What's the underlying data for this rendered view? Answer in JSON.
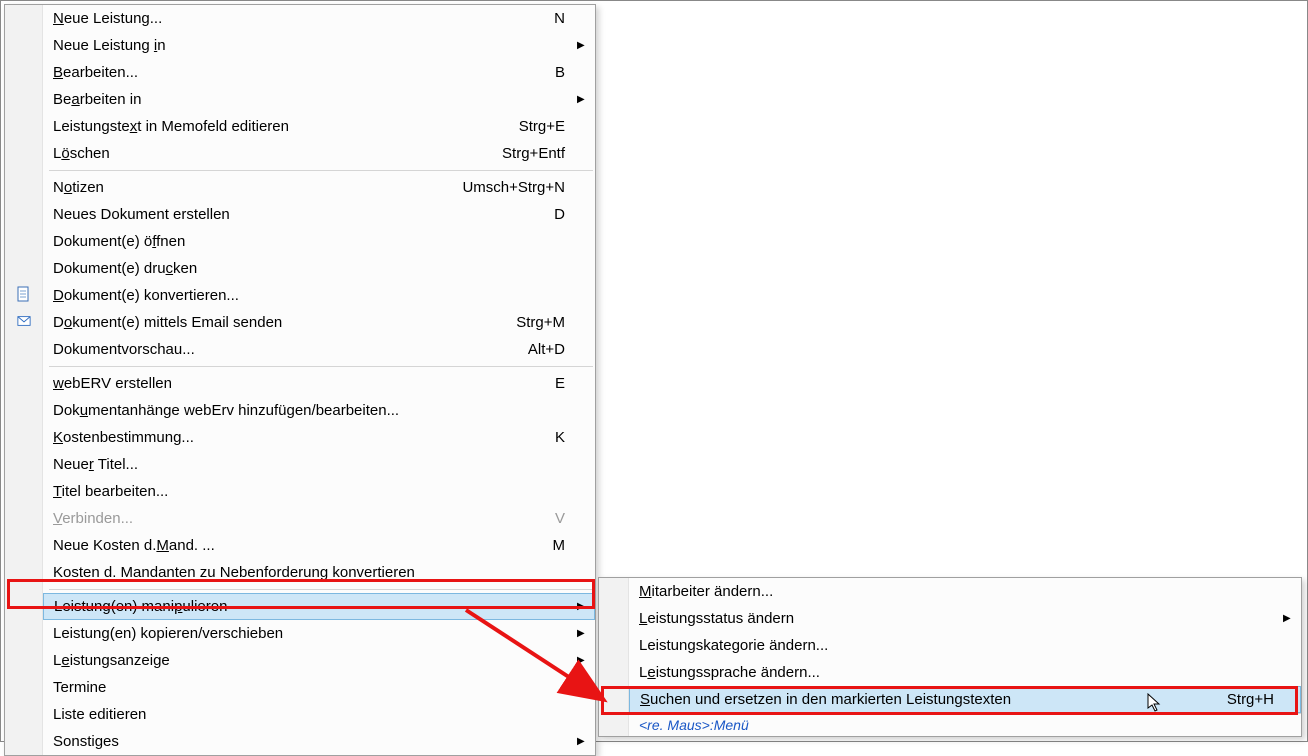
{
  "mainMenu": {
    "items": [
      {
        "type": "item",
        "pre": "",
        "u": "N",
        "post": "eue Leistung...",
        "shortcut": "N",
        "arrow": false
      },
      {
        "type": "item",
        "pre": "Neue Leistung ",
        "u": "i",
        "post": "n",
        "shortcut": "",
        "arrow": true
      },
      {
        "type": "item",
        "pre": "",
        "u": "B",
        "post": "earbeiten...",
        "shortcut": "B",
        "arrow": false
      },
      {
        "type": "item",
        "pre": "Be",
        "u": "a",
        "post": "rbeiten in",
        "shortcut": "",
        "arrow": true
      },
      {
        "type": "item",
        "pre": "Leistungste",
        "u": "x",
        "post": "t in Memofeld editieren",
        "shortcut": "Strg+E",
        "arrow": false
      },
      {
        "type": "item",
        "pre": "L",
        "u": "ö",
        "post": "schen",
        "shortcut": "Strg+Entf",
        "arrow": false
      },
      {
        "type": "sep"
      },
      {
        "type": "item",
        "pre": "N",
        "u": "o",
        "post": "tizen",
        "shortcut": "Umsch+Strg+N",
        "arrow": false
      },
      {
        "type": "item",
        "pre": "Neues Dokument erstellen",
        "u": "",
        "post": "",
        "shortcut": "D",
        "arrow": false
      },
      {
        "type": "item",
        "pre": "Dokument(e) ö",
        "u": "f",
        "post": "fnen",
        "shortcut": "",
        "arrow": false
      },
      {
        "type": "item",
        "pre": "Dokument(e) dru",
        "u": "c",
        "post": "ken",
        "shortcut": "",
        "arrow": false
      },
      {
        "type": "item",
        "pre": "",
        "u": "D",
        "post": "okument(e) konvertieren...",
        "shortcut": "",
        "arrow": false,
        "icon": "doc"
      },
      {
        "type": "item",
        "pre": "D",
        "u": "o",
        "post": "kument(e) mittels Email senden",
        "shortcut": "Strg+M",
        "arrow": false,
        "icon": "mail"
      },
      {
        "type": "item",
        "pre": "Dokumentvorschau...",
        "u": "",
        "post": "",
        "shortcut": "Alt+D",
        "arrow": false
      },
      {
        "type": "sep"
      },
      {
        "type": "item",
        "pre": "",
        "u": "w",
        "post": "ebERV erstellen",
        "shortcut": "E",
        "arrow": false
      },
      {
        "type": "item",
        "pre": "Dok",
        "u": "u",
        "post": "mentanhänge webErv hinzufügen/bearbeiten...",
        "shortcut": "",
        "arrow": false
      },
      {
        "type": "item",
        "pre": "",
        "u": "K",
        "post": "ostenbestimmung...",
        "shortcut": "K",
        "arrow": false
      },
      {
        "type": "item",
        "pre": "Neue",
        "u": "r",
        "post": " Titel...",
        "shortcut": "",
        "arrow": false
      },
      {
        "type": "item",
        "pre": "",
        "u": "T",
        "post": "itel bearbeiten...",
        "shortcut": "",
        "arrow": false
      },
      {
        "type": "item",
        "pre": "",
        "u": "V",
        "post": "erbinden...",
        "shortcut": "V",
        "arrow": false,
        "disabled": true
      },
      {
        "type": "item",
        "pre": "Neue Kosten d.",
        "u": "M",
        "post": "and. ...",
        "shortcut": "M",
        "arrow": false
      },
      {
        "type": "item",
        "pre": "Kosten d. Mandanten zu Nebenforderung konvertieren",
        "u": "",
        "post": "",
        "shortcut": "",
        "arrow": false
      },
      {
        "type": "sep"
      },
      {
        "type": "item",
        "pre": "Leistung(en) mani",
        "u": "p",
        "post": "ulieren",
        "shortcut": "",
        "arrow": true,
        "selected": true
      },
      {
        "type": "item",
        "pre": "Leistung(en) kopieren/verschieben",
        "u": "",
        "post": "",
        "shortcut": "",
        "arrow": true
      },
      {
        "type": "item",
        "pre": "L",
        "u": "e",
        "post": "istungsanzeige",
        "shortcut": "",
        "arrow": true
      },
      {
        "type": "item",
        "pre": "Termine",
        "u": "",
        "post": "",
        "shortcut": "",
        "arrow": true
      },
      {
        "type": "item",
        "pre": "Liste editieren",
        "u": "",
        "post": "",
        "shortcut": "",
        "arrow": false
      },
      {
        "type": "item",
        "pre": "Sonstiges",
        "u": "",
        "post": "",
        "shortcut": "",
        "arrow": true
      }
    ]
  },
  "subMenu": {
    "items": [
      {
        "type": "item",
        "pre": "",
        "u": "M",
        "post": "itarbeiter ändern...",
        "shortcut": "",
        "arrow": false
      },
      {
        "type": "item",
        "pre": "",
        "u": "L",
        "post": "eistungsstatus ändern",
        "shortcut": "",
        "arrow": true
      },
      {
        "type": "item",
        "pre": "Leistungskategorie ändern...",
        "u": "",
        "post": "",
        "shortcut": "",
        "arrow": false
      },
      {
        "type": "item",
        "pre": "L",
        "u": "e",
        "post": "istungssprache ändern...",
        "shortcut": "",
        "arrow": false
      },
      {
        "type": "item",
        "pre": "",
        "u": "S",
        "post": "uchen und ersetzen in den markierten Leistungstexten",
        "shortcut": "Strg+H",
        "arrow": false,
        "selected": true
      }
    ],
    "footer": "<re. Maus>:Menü"
  }
}
